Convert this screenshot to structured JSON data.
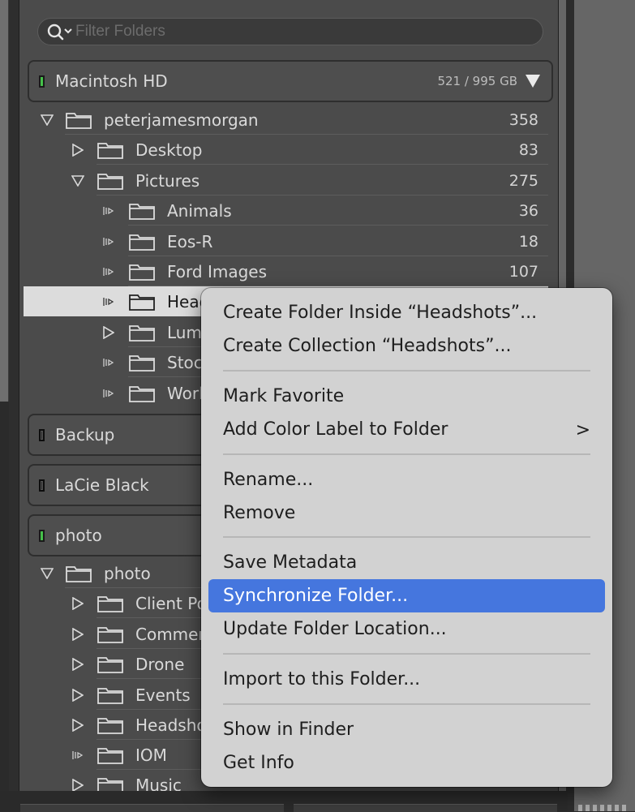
{
  "filter": {
    "placeholder": "Filter Folders"
  },
  "volumes": [
    {
      "name": "Macintosh HD",
      "info": "521 / 995 GB",
      "status": "on"
    },
    {
      "name": "Backup",
      "status": "off"
    },
    {
      "name": "LaCie Black",
      "status": "off"
    },
    {
      "name": "photo",
      "status": "on"
    }
  ],
  "tree1": {
    "root": {
      "label": "peterjamesmorgan",
      "count": "358"
    },
    "desktop": {
      "label": "Desktop",
      "count": "83"
    },
    "pictures": {
      "label": "Pictures",
      "count": "275"
    },
    "children": [
      {
        "label": "Animals",
        "count": "36"
      },
      {
        "label": "Eos-R",
        "count": "18"
      },
      {
        "label": "Ford Images",
        "count": "107"
      },
      {
        "label": "Headshots",
        "count": ""
      },
      {
        "label": "Luminar",
        "count": ""
      },
      {
        "label": "Stock",
        "count": ""
      },
      {
        "label": "Work",
        "count": ""
      }
    ]
  },
  "tree2": {
    "root": {
      "label": "photo"
    },
    "children": [
      {
        "label": "Client Portraits"
      },
      {
        "label": "Commercial"
      },
      {
        "label": "Drone"
      },
      {
        "label": "Events"
      },
      {
        "label": "Headshots"
      },
      {
        "label": "IOM"
      },
      {
        "label": "Music"
      }
    ]
  },
  "menu": {
    "create_folder": "Create Folder Inside “Headshots”...",
    "create_collection": "Create Collection “Headshots”...",
    "mark_favorite": "Mark Favorite",
    "add_color_label": "Add Color Label to Folder",
    "rename": "Rename...",
    "remove": "Remove",
    "save_metadata": "Save Metadata",
    "synchronize": "Synchronize Folder...",
    "update_location": "Update Folder Location...",
    "import": "Import to this Folder...",
    "show_in_finder": "Show in Finder",
    "get_info": "Get Info",
    "submenu_chevron": ">"
  },
  "colors": {
    "highlight": "#4576de",
    "led_on": "#45c04a"
  }
}
